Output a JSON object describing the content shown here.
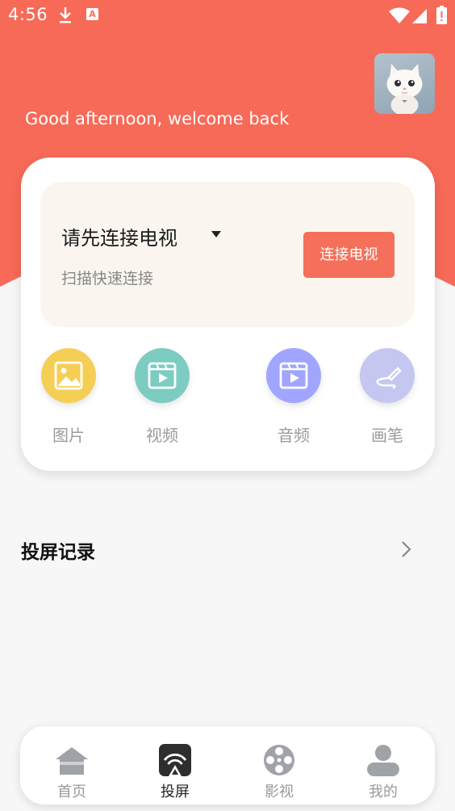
{
  "colors": {
    "accent": "#f4705a",
    "panel": "#faf6ef",
    "background": "#f7f7f7"
  },
  "status_bar": {
    "time": "4:56",
    "icons": [
      "download-icon",
      "a-icon",
      "wifi-icon",
      "signal-icon",
      "battery-icon"
    ]
  },
  "header": {
    "greeting": "Good afternoon, welcome back",
    "avatar_icon": "cat-avatar"
  },
  "connect": {
    "device_prompt": "请先连接电视",
    "scan_hint": "扫描快速连接",
    "button_label": "连接电视"
  },
  "features": [
    {
      "label": "图片",
      "icon": "image-icon",
      "color": "#f5cf55"
    },
    {
      "label": "视频",
      "icon": "video-icon",
      "color": "#7cccc2"
    },
    {
      "label": "音频",
      "icon": "audio-icon",
      "color": "#a0a6ff"
    },
    {
      "label": "画笔",
      "icon": "brush-icon",
      "color": "#c6c7f0"
    }
  ],
  "history": {
    "title": "投屏记录"
  },
  "bottom_nav": {
    "items": [
      {
        "label": "首页",
        "icon": "home-icon",
        "active": false
      },
      {
        "label": "投屏",
        "icon": "cast-icon",
        "active": true
      },
      {
        "label": "影视",
        "icon": "film-reel-icon",
        "active": false
      },
      {
        "label": "我的",
        "icon": "profile-icon",
        "active": false
      }
    ]
  }
}
